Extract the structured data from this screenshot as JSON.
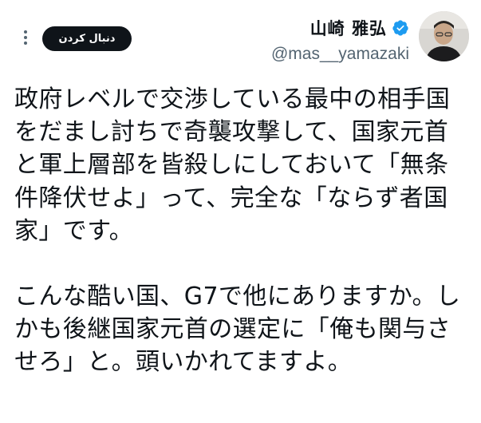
{
  "header": {
    "display_name": "山崎 雅弘",
    "handle": "@mas__yamazaki",
    "follow_label": "دنبال کردن",
    "more_icon": "more-vertical-icon",
    "verified_icon": "verified-badge-icon",
    "verified_color": "#1d9bf0"
  },
  "tweet": {
    "paragraph1": [
      "政府レベルで交渉している最中の相手国",
      "をだまし討ちで奇襲攻撃して、国家元首",
      "と軍上層部を皆殺しにしておいて「無条",
      "件降伏せよ」って、完全な「ならず者国",
      "家」です。"
    ],
    "paragraph2": [
      "こんな酷い国、G7で他にありますか。し",
      "かも後継国家元首の選定に「俺も関与さ",
      "せろ」と。頭いかれてますよ。"
    ]
  }
}
